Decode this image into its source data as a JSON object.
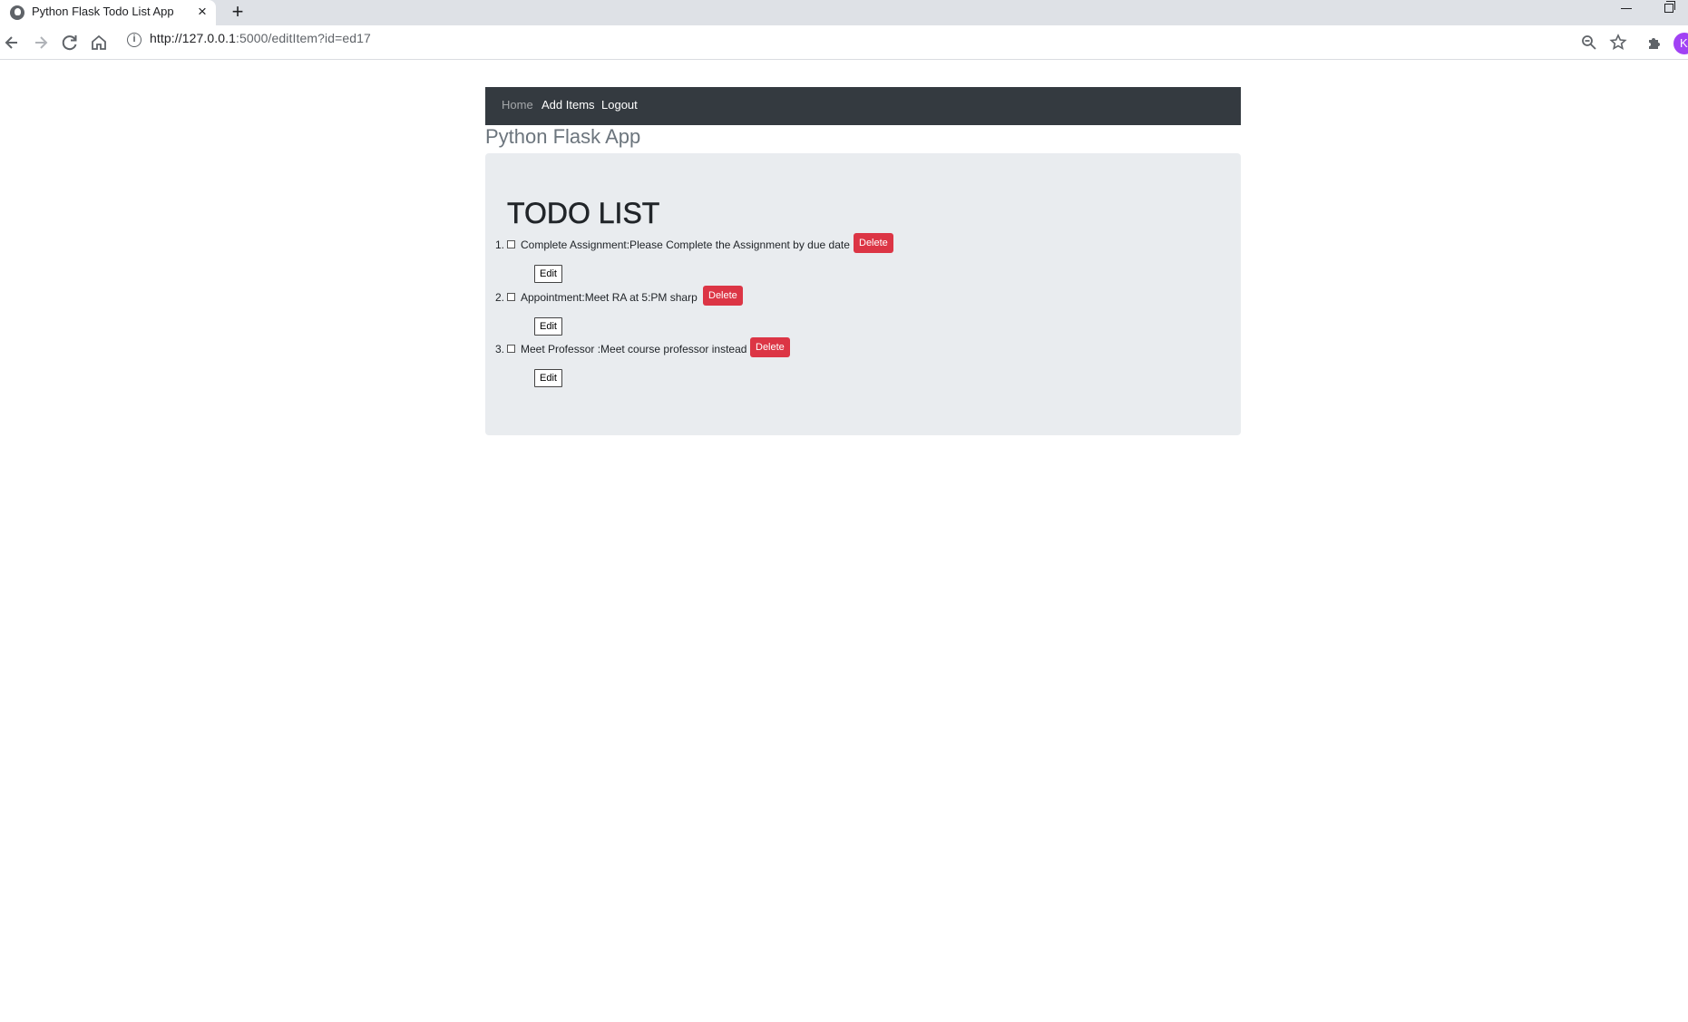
{
  "browser": {
    "tab_title": "Python Flask Todo List App",
    "tab_close_icon": "×",
    "new_tab_icon": "+",
    "url_host": "http://127.0.0.1",
    "url_rest": ":5000/editItem?id=ed17",
    "avatar_initial": "K",
    "icons": [
      "back-icon",
      "forward-icon",
      "reload-icon",
      "home-icon",
      "info-icon",
      "zoom-icon",
      "star-icon",
      "extensions-icon"
    ]
  },
  "nav": {
    "home": "Home",
    "add_items": "Add Items",
    "logout": "Logout"
  },
  "app_title": "Python Flask App",
  "todo": {
    "heading": "TODO LIST",
    "delete_label": "Delete",
    "edit_label": "Edit",
    "items": [
      {
        "number": "1.",
        "text": "Complete Assignment:Please Complete the Assignment by due date",
        "checked": false
      },
      {
        "number": "2.",
        "text": "Appointment:Meet RA at 5:PM sharp",
        "checked": false
      },
      {
        "number": "3.",
        "text": "Meet Professor :Meet course professor instead",
        "checked": false
      }
    ]
  },
  "colors": {
    "navbar_bg": "#343a40",
    "jumbotron_bg": "#e9ecef",
    "delete_bg": "#dc3545",
    "title_color": "#6c757d"
  }
}
